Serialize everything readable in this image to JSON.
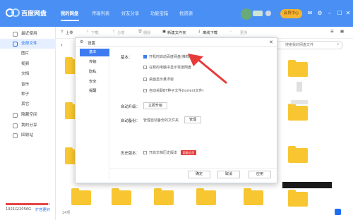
{
  "app": {
    "title": "百度网盘"
  },
  "nav": {
    "tabs": [
      "我的网盘",
      "传输列表",
      "好友分享",
      "功能宝箱",
      "找资源"
    ]
  },
  "header": {
    "member_label": "会员中心"
  },
  "sidebar": {
    "items": [
      "最近使用",
      "全部文件",
      "图片",
      "视频",
      "文档",
      "音乐",
      "种子",
      "其它",
      "隐藏空间",
      "我的分享",
      "回收站"
    ],
    "storage_text": "1921G/2056G",
    "expand_label": "扩容更好"
  },
  "toolbar": {
    "items": [
      "上传",
      "下载",
      "分享",
      "删除",
      "新建文件夹",
      "离线下载",
      "更多"
    ]
  },
  "search": {
    "placeholder": "搜索我的网盘文件"
  },
  "status": {
    "item_count": "24项"
  },
  "dialog": {
    "title": "设置",
    "nav": [
      "基本",
      "传输",
      "隐私",
      "安全",
      "提醒"
    ],
    "basic_label": "基本：",
    "options": [
      {
        "text": "开机时启动百度网盘(推荐)",
        "checked": true
      },
      {
        "text": "在我的电脑中显示百度网盘",
        "checked": false
      },
      {
        "text": "桌面显示悬浮窗",
        "checked": false
      },
      {
        "text": "自动关联BT种子文件(torrent文件)",
        "checked": false
      }
    ],
    "auto_upgrade_label": "自动升级：",
    "upgrade_button": "立即升级",
    "auto_backup_label": "自动备份：",
    "backup_text": "管理自动备份的文件夹",
    "manage_button": "管理",
    "history_label": "历史版本：",
    "history_option": "开启文档历史版本",
    "vip_badge": "超级会员",
    "footer_buttons": [
      "确定",
      "取消",
      "应用"
    ]
  },
  "colors": {
    "titlebar": "#4a90f4",
    "accent": "#3e7bf1",
    "folder": "#f8c630",
    "arrow": "#e53b3b"
  }
}
